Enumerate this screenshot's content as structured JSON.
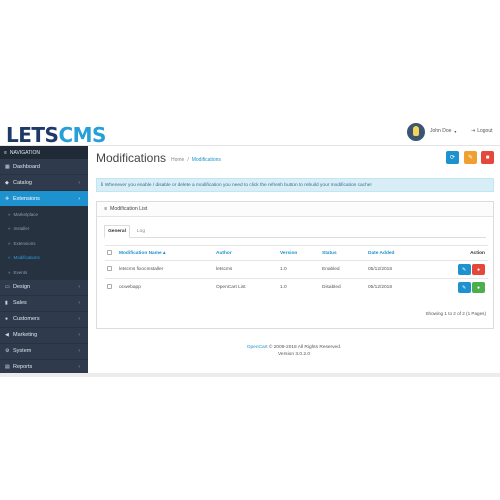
{
  "logo": {
    "part1": "LETS",
    "part2": "CMS"
  },
  "header": {
    "user_name": "John Doe",
    "user_caret": "▾",
    "logout_label": "Logout",
    "logout_icon": "⇥"
  },
  "nav": {
    "heading": "NAVIGATION",
    "items": [
      {
        "label": "Dashboard",
        "icon": "▦"
      },
      {
        "label": "Catalog",
        "icon": "◆"
      },
      {
        "label": "Extensions",
        "icon": "✚"
      },
      {
        "label": "Design",
        "icon": "▭"
      },
      {
        "label": "Sales",
        "icon": "▮"
      },
      {
        "label": "Customers",
        "icon": "●"
      },
      {
        "label": "Marketing",
        "icon": "◀"
      },
      {
        "label": "System",
        "icon": "⚙"
      },
      {
        "label": "Reports",
        "icon": "▤"
      }
    ],
    "sub_items": [
      {
        "label": "Marketplace"
      },
      {
        "label": "Installer"
      },
      {
        "label": "Extensions"
      },
      {
        "label": "Modifications"
      },
      {
        "label": "Events"
      }
    ],
    "arrow": "›",
    "sub_bullet": "»"
  },
  "page": {
    "title": "Modifications",
    "breadcrumb_home": "Home",
    "breadcrumb_sep": "/",
    "breadcrumb_current": "Modifications",
    "buttons": {
      "refresh": "⟳",
      "clear": "✎",
      "delete": "■"
    },
    "colors": {
      "refresh": "#1e91cf",
      "clear": "#f0a030",
      "delete": "#e4473c"
    }
  },
  "alert": {
    "icon": "ℹ",
    "text": "Whenever you enable / disable or delete a modification you need to click the refresh button to rebuild your modification cache!"
  },
  "panel": {
    "title": "Modification List",
    "title_icon": "≡",
    "tabs": [
      "General",
      "Log"
    ],
    "columns": [
      "Modification Name ▴",
      "Author",
      "Version",
      "Status",
      "Date Added",
      "Action"
    ],
    "rows": [
      {
        "name": "letscms fixocInstaller",
        "author": "letscms",
        "version": "1.0",
        "status": "Enabled",
        "date": "05/12/2018",
        "edit_icon": "✎",
        "toggle_icon": "●",
        "toggle_color": "#e4473c"
      },
      {
        "name": "ocwebapp",
        "author": "OpenCart List",
        "version": "1.0",
        "status": "Disabled",
        "date": "05/12/2018",
        "edit_icon": "✎",
        "toggle_icon": "●",
        "toggle_color": "#4cae4c"
      }
    ],
    "showing": "Showing 1 to 2 of 2 (1 Pages)"
  },
  "footer": {
    "brand": "OpenCart",
    "copyright": " © 2009-2018 All Rights Reserved.",
    "version": "Version 3.0.2.0"
  }
}
